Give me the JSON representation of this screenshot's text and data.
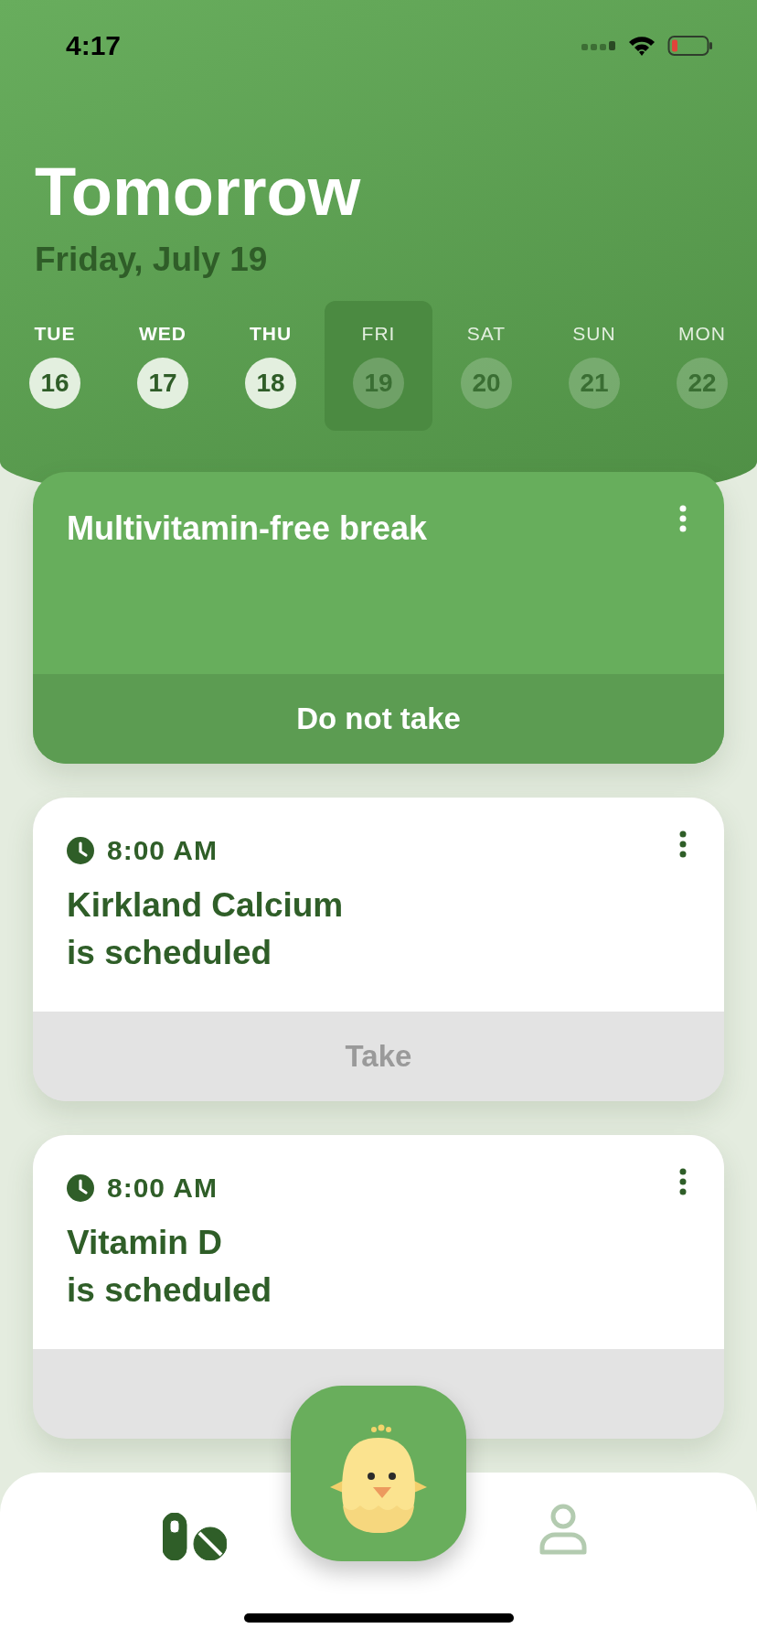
{
  "status_bar": {
    "time": "4:17"
  },
  "header": {
    "title": "Tomorrow",
    "date": "Friday, July 19"
  },
  "days": [
    {
      "weekday": "TUE",
      "day": "16",
      "past": true,
      "selected": false
    },
    {
      "weekday": "WED",
      "day": "17",
      "past": true,
      "selected": false
    },
    {
      "weekday": "THU",
      "day": "18",
      "past": true,
      "selected": false
    },
    {
      "weekday": "FRI",
      "day": "19",
      "past": false,
      "selected": true
    },
    {
      "weekday": "SAT",
      "day": "20",
      "past": false,
      "selected": false
    },
    {
      "weekday": "SUN",
      "day": "21",
      "past": false,
      "selected": false
    },
    {
      "weekday": "MON",
      "day": "22",
      "past": false,
      "selected": false
    }
  ],
  "cards": [
    {
      "kind": "break",
      "title": "Multivitamin-free break",
      "action": "Do not take"
    },
    {
      "kind": "dose",
      "time": "8:00 AM",
      "name": "Kirkland Calcium",
      "status": "is scheduled",
      "action": "Take"
    },
    {
      "kind": "dose",
      "time": "8:00 AM",
      "name": "Vitamin D",
      "status": "is scheduled"
    }
  ],
  "tab_bar": {
    "tabs": [
      {
        "kind": "pills",
        "selected": true
      },
      {
        "kind": "profile",
        "selected": false
      }
    ]
  }
}
